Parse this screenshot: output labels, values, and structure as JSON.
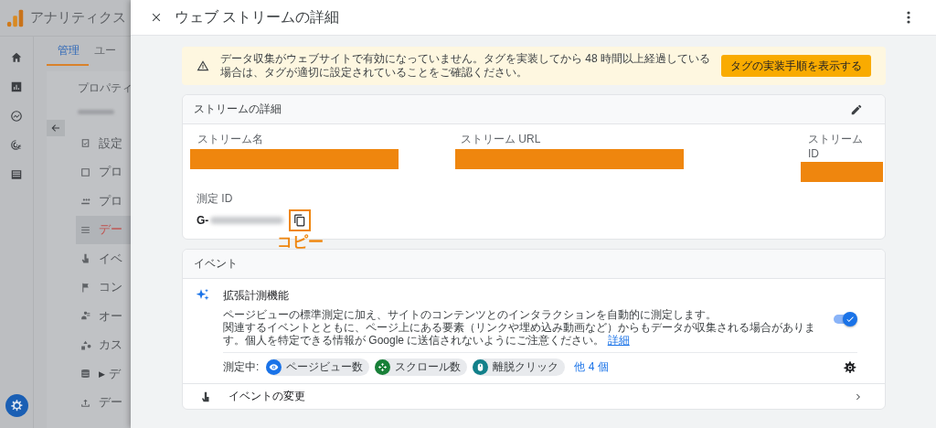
{
  "app": {
    "title": "アナリティクス"
  },
  "admin_nav": {
    "tabs": [
      {
        "label": "管理",
        "selected": true
      },
      {
        "label": "ユー",
        "selected": false
      }
    ],
    "property_label": "プロパティ",
    "items": [
      {
        "label": "設定",
        "selected": false
      },
      {
        "label": "プロ",
        "selected": false
      },
      {
        "label": "プロ",
        "selected": false
      },
      {
        "label": "デー",
        "selected": true
      },
      {
        "label": "イベ",
        "selected": false
      },
      {
        "label": "コン",
        "selected": false
      },
      {
        "label": "オー",
        "selected": false
      },
      {
        "label": "カス",
        "selected": false
      },
      {
        "label": "デ",
        "selected": false,
        "marker": "▶"
      },
      {
        "label": "デー",
        "selected": false
      }
    ]
  },
  "panel": {
    "title": "ウェブ ストリームの詳細"
  },
  "alert": {
    "text": "データ収集がウェブサイトで有効になっていません。タグを実装してから 48 時間以上経過している場合は、タグが適切に設定されていることをご確認ください。",
    "button": "タグの実装手順を表示する"
  },
  "stream_card": {
    "title": "ストリームの詳細",
    "fields": [
      {
        "label": "ストリーム名"
      },
      {
        "label": "ストリーム URL"
      },
      {
        "label": "ストリーム ID"
      }
    ],
    "measurement_id": {
      "label": "測定 ID",
      "value": "G-"
    },
    "annotation": "コピー"
  },
  "events_card": {
    "title": "イベント",
    "enhanced": {
      "title": "拡張計測機能",
      "description": [
        "ページビューの標準測定に加え、サイトのコンテンツとのインタラクションを自動的に測定します。",
        "関連するイベントとともに、ページ上にある要素（リンクや埋め込み動画など）からもデータが収集される場合があります。個人を特定できる情報が Google に送信されないようにご注意ください。"
      ],
      "link": "詳細",
      "on": true,
      "measuring_label": "測定中:",
      "chips": [
        {
          "label": "ページビュー数",
          "color": "#1a73e8"
        },
        {
          "label": "スクロール数",
          "color": "#188038"
        },
        {
          "label": "離脱クリック",
          "color": "#12808a"
        }
      ],
      "more": "他 4 個"
    },
    "rows": [
      {
        "title": "イベントの変更"
      }
    ]
  }
}
